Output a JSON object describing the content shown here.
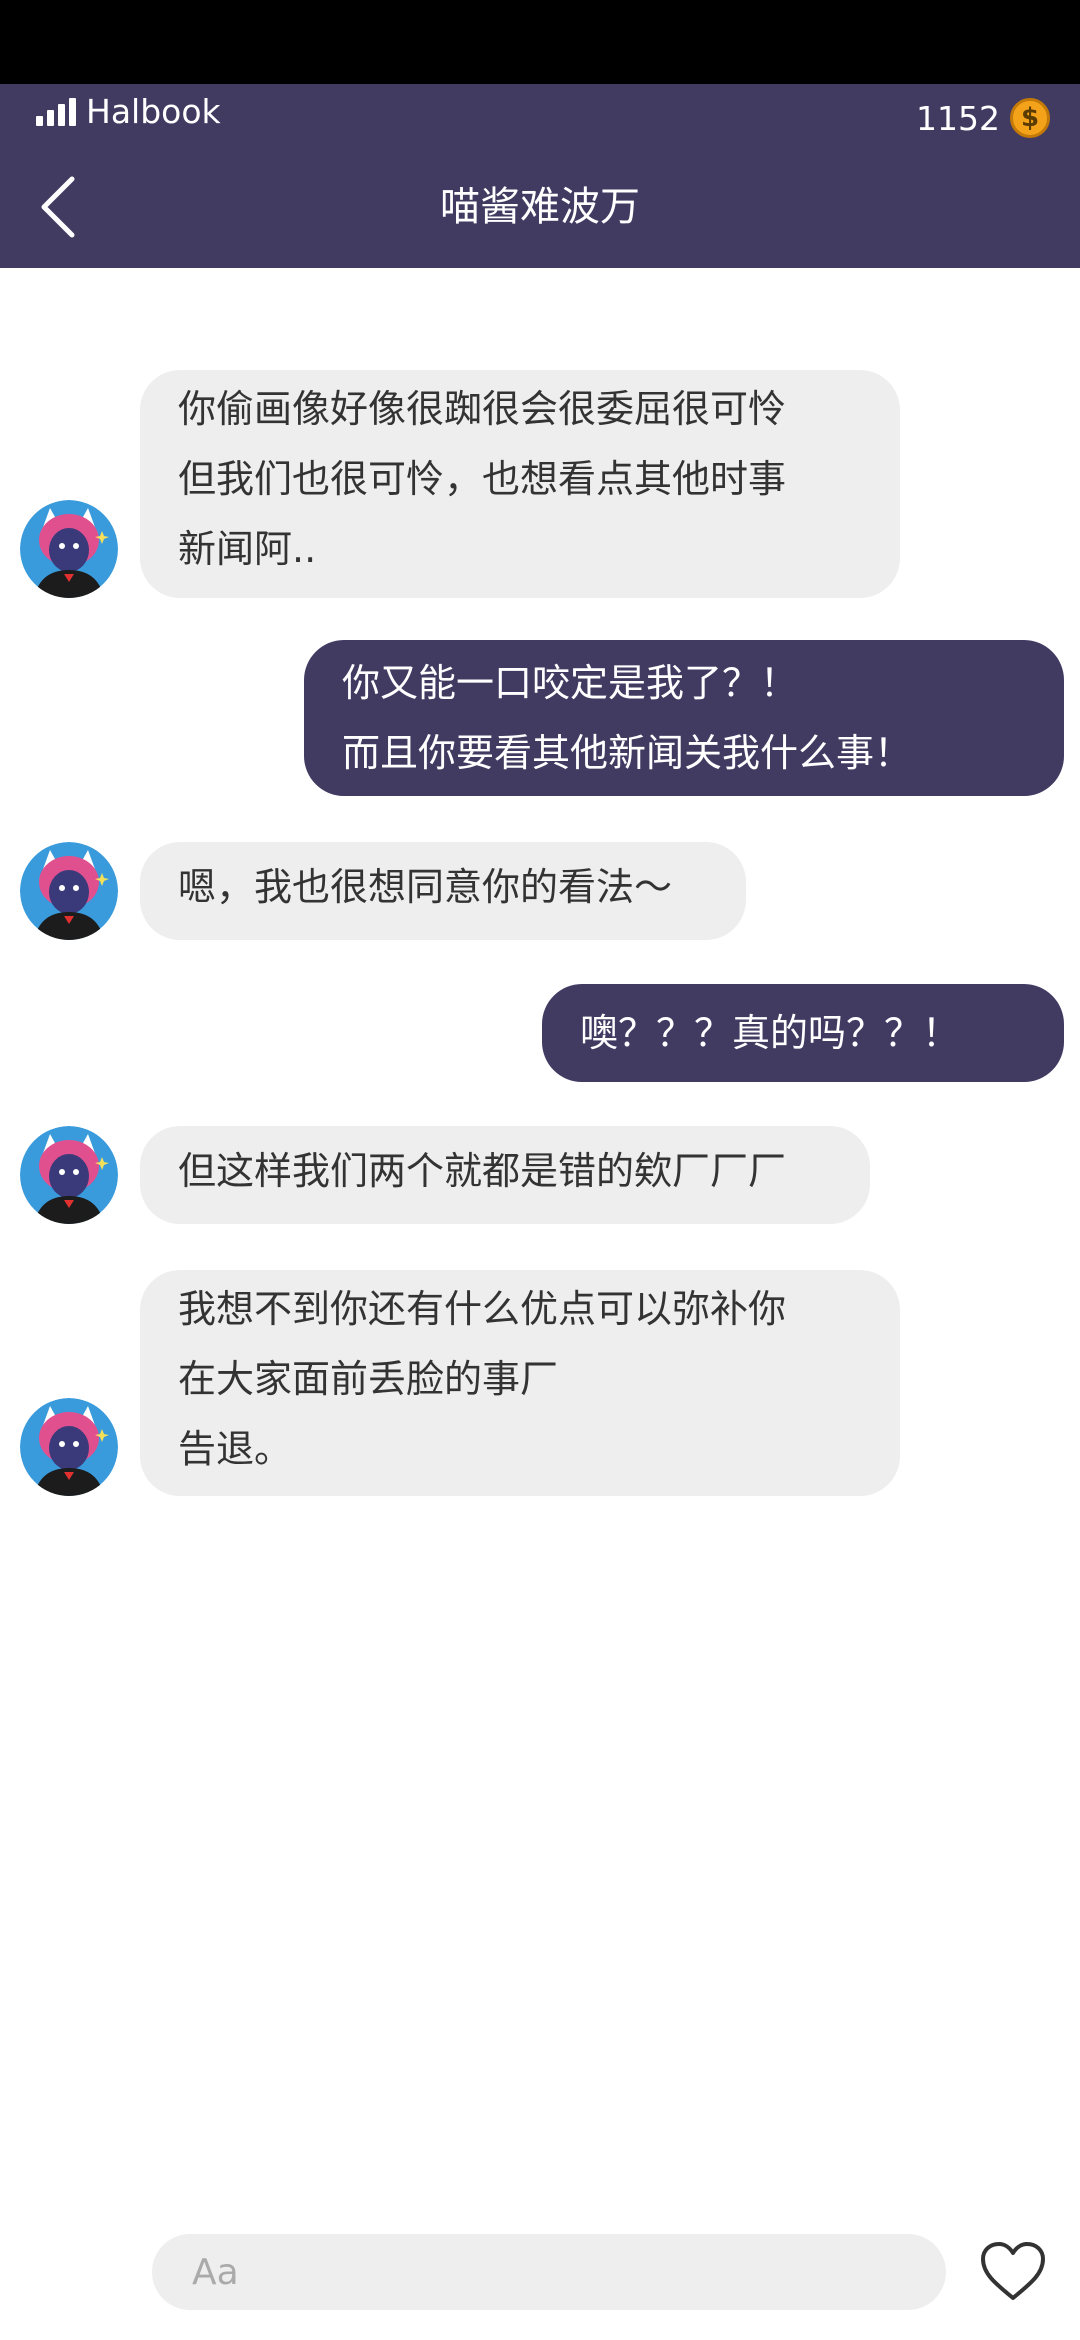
{
  "status_bar": {
    "carrier": "Halbook",
    "coins": "1152",
    "coin_symbol": "$"
  },
  "header": {
    "title": "喵酱难波万",
    "back_icon": "chevron-left-icon"
  },
  "messages": [
    {
      "direction": "incoming",
      "text": "你偷画像好像很踟很会很委屈很可怜\n但我们也很可怜，也想看点其他时事\n新闻阿.."
    },
    {
      "direction": "outgoing",
      "text": "你又能一口咬定是我了？！\n而且你要看其他新闻关我什么事！"
    },
    {
      "direction": "incoming",
      "text": "嗯，我也很想同意你的看法～"
    },
    {
      "direction": "outgoing",
      "text": "噢？？？真的吗？？！"
    },
    {
      "direction": "incoming",
      "text": "但这样我们两个就都是错的欸厂厂厂"
    },
    {
      "direction": "incoming",
      "text": "我想不到你还有什么优点可以弥补你\n在大家面前丢脸的事厂\n告退。"
    }
  ],
  "composer": {
    "placeholder": "Aa",
    "value": "",
    "like_icon": "heart-icon"
  },
  "colors": {
    "header_bg": "#413b62",
    "outgoing_bubble": "#413b62",
    "incoming_bubble": "#eeeeee",
    "coin": "#f5a21b"
  }
}
